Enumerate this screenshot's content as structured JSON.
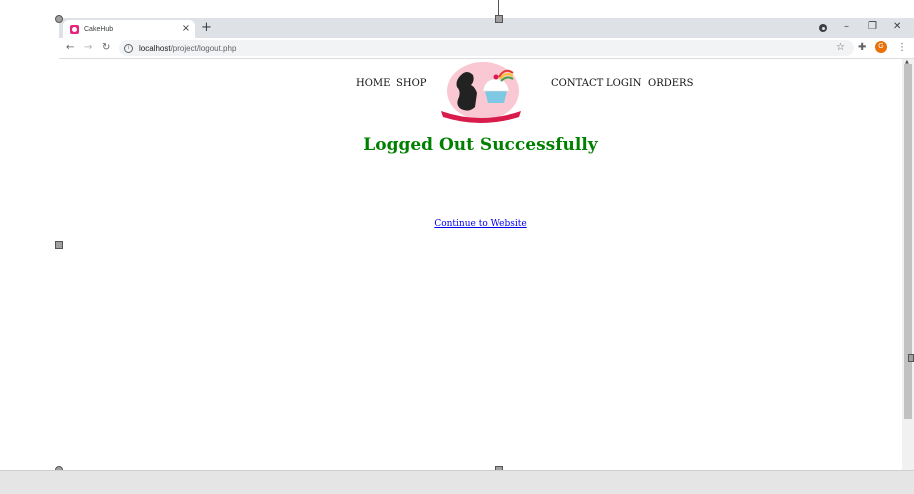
{
  "browser": {
    "tab_title": "CakeHub",
    "tab_close": "×",
    "new_tab": "+",
    "minimize": "–",
    "restore": "❐",
    "close": "✕",
    "back": "←",
    "forward": "→",
    "reload": "↻",
    "url_host": "localhost",
    "url_path": "/project/logout.php",
    "star": "☆",
    "extensions": "✚",
    "profile_initial": "G",
    "menu": "⋮"
  },
  "site": {
    "nav_left": [
      "HOME",
      "SHOP"
    ],
    "nav_right": [
      "CONTACT",
      "LOGIN",
      "ORDERS"
    ],
    "heading": "Logged Out Successfully",
    "continue_link": "Continue to Website"
  },
  "colors": {
    "heading": "#008000",
    "link": "#0000ee",
    "logo_bg": "#f9c8d3",
    "logo_ribbon": "#d81b4b"
  },
  "icons": [
    "cakehub-favicon",
    "info-icon",
    "star-icon",
    "puzzle-icon",
    "menu-icon",
    "back-icon",
    "forward-icon",
    "reload-icon",
    "record-icon"
  ]
}
